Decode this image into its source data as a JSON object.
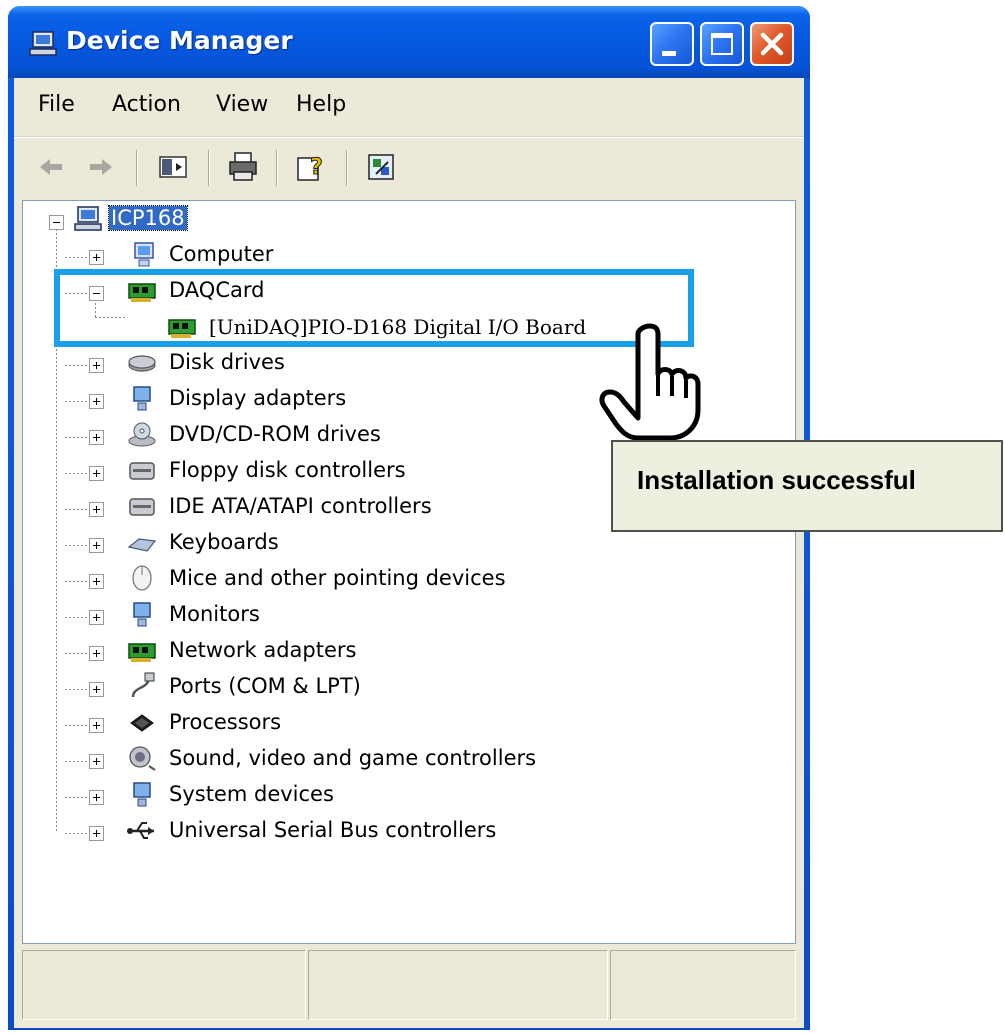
{
  "window": {
    "title": "Device Manager",
    "buttons": {
      "minimize": "minimize",
      "maximize": "maximize",
      "close": "close"
    }
  },
  "menu": {
    "items": [
      {
        "label": "File"
      },
      {
        "label": "Action"
      },
      {
        "label": "View"
      },
      {
        "label": "Help"
      }
    ]
  },
  "toolbar": {
    "buttons": [
      "back-arrow-icon",
      "forward-arrow-icon",
      "show-hide-console-tree-icon",
      "print-icon",
      "help-icon",
      "update-driver-icon"
    ]
  },
  "tree": {
    "root": {
      "label": "ICP168",
      "expanded": true,
      "selected": true
    },
    "nodes": [
      {
        "label": "Computer",
        "icon": "computer-icon",
        "expanded": false
      },
      {
        "label": "DAQCard",
        "icon": "daq-card-icon",
        "expanded": true,
        "children": [
          {
            "label": "[UniDAQ]PIO-D168 Digital I/O Board",
            "icon": "io-board-icon"
          }
        ]
      },
      {
        "label": "Disk drives",
        "icon": "disk-drive-icon",
        "expanded": false
      },
      {
        "label": "Display adapters",
        "icon": "display-adapter-icon",
        "expanded": false
      },
      {
        "label": "DVD/CD-ROM drives",
        "icon": "cdrom-icon",
        "expanded": false
      },
      {
        "label": "Floppy disk controllers",
        "icon": "floppy-controller-icon",
        "expanded": false
      },
      {
        "label": "IDE ATA/ATAPI controllers",
        "icon": "ide-controller-icon",
        "expanded": false
      },
      {
        "label": "Keyboards",
        "icon": "keyboard-icon",
        "expanded": false
      },
      {
        "label": "Mice and other pointing devices",
        "icon": "mouse-icon",
        "expanded": false
      },
      {
        "label": "Monitors",
        "icon": "monitor-icon",
        "expanded": false
      },
      {
        "label": "Network adapters",
        "icon": "network-adapter-icon",
        "expanded": false
      },
      {
        "label": "Ports (COM & LPT)",
        "icon": "port-icon",
        "expanded": false
      },
      {
        "label": "Processors",
        "icon": "processor-icon",
        "expanded": false
      },
      {
        "label": "Sound, video and game controllers",
        "icon": "sound-icon",
        "expanded": false
      },
      {
        "label": "System devices",
        "icon": "system-device-icon",
        "expanded": false
      },
      {
        "label": "Universal Serial Bus controllers",
        "icon": "usb-icon",
        "expanded": false
      }
    ]
  },
  "annotation": {
    "callout_text": "Installation successful",
    "highlight_color": "#1aa0e8",
    "callout_background": "#ebf1de"
  },
  "colors": {
    "title_bar": "#0658e0",
    "client_background": "#ece9d8",
    "selection": "#316ac5"
  }
}
